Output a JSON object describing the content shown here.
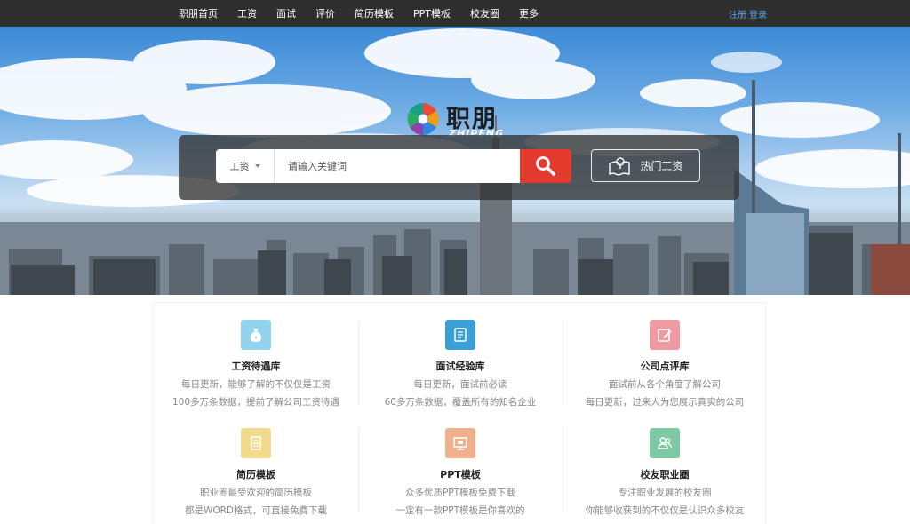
{
  "nav": {
    "items": [
      "职朋首页",
      "工资",
      "面试",
      "评价",
      "简历模板",
      "PPT模板",
      "校友圈",
      "更多"
    ],
    "register": "注册",
    "login": "登录"
  },
  "brand": {
    "name": "职朋",
    "latin": "ZHIPENG"
  },
  "search": {
    "category": "工资",
    "placeholder": "请输入关键词",
    "hot_label": "热门工资"
  },
  "features": [
    {
      "icon": "money-bag-icon",
      "color": "#8fd3ee",
      "title": "工资待遇库",
      "line1": "每日更新，能够了解的不仅仅是工资",
      "line2": "100多万条数据，提前了解公司工资待遇"
    },
    {
      "icon": "book-icon",
      "color": "#3a9fd6",
      "title": "面试经验库",
      "line1": "每日更新，面试前必读",
      "line2": "60多万条数据，覆盖所有的知名企业"
    },
    {
      "icon": "edit-icon",
      "color": "#ee9aa0",
      "title": "公司点评库",
      "line1": "面试前从各个角度了解公司",
      "line2": "每日更新，过来人为您展示真实的公司"
    },
    {
      "icon": "resume-icon",
      "color": "#f2dc8c",
      "title": "简历模板",
      "line1": "职业圈最受欢迎的简历模板",
      "line2": "都是WORD格式，可直接免费下载"
    },
    {
      "icon": "presentation-icon",
      "color": "#f0b08c",
      "title": "PPT模板",
      "line1": "众多优质PPT模板免费下载",
      "line2": "一定有一款PPT模板是你喜欢的"
    },
    {
      "icon": "users-icon",
      "color": "#7dc9a4",
      "title": "校友职业圈",
      "line1": "专注职业发展的校友圈",
      "line2": "你能够收获到的不仅仅是认识众多校友"
    }
  ]
}
